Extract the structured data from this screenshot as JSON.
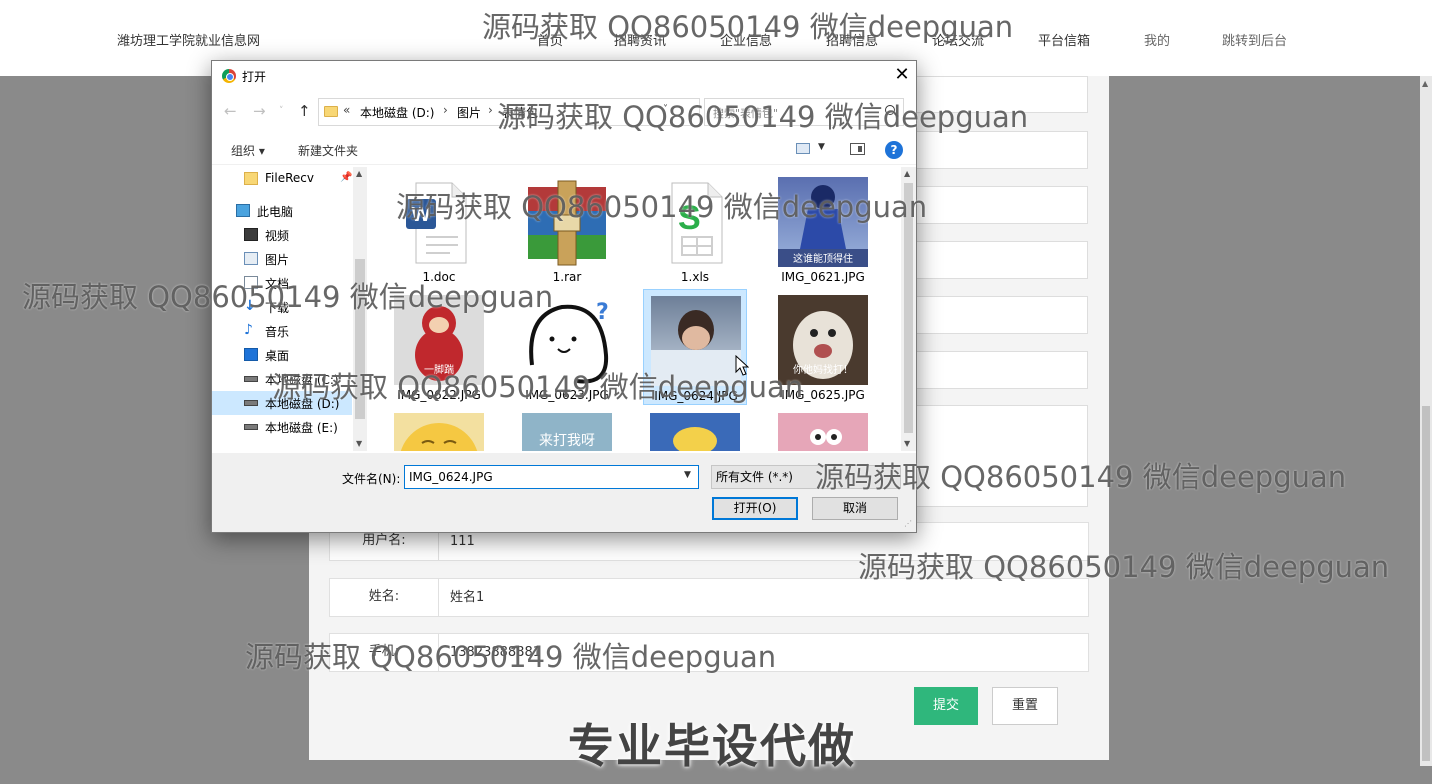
{
  "site": {
    "title": "潍坊理工学院就业信息网",
    "nav": [
      "首页",
      "招聘资讯",
      "企业信息",
      "招聘信息",
      "论坛交流",
      "平台信箱",
      "我的",
      "跳转到后台"
    ]
  },
  "form": {
    "username_label": "用户名:",
    "username_value": "111",
    "name_label": "姓名:",
    "name_value": "姓名1",
    "phone_label": "手机:",
    "phone_value": "13823888881",
    "submit_label": "提交",
    "reset_label": "重置"
  },
  "dialog": {
    "title": "打开",
    "close_glyph": "✕",
    "breadcrumb": [
      "本地磁盘 (D:)",
      "图片",
      "表情包"
    ],
    "breadcrumb_overflow": "«",
    "search_placeholder": "搜索\"表情包\"",
    "organize_label": "组织 ▾",
    "new_folder_label": "新建文件夹",
    "help_glyph": "?",
    "nav_tree": [
      {
        "label": "FileRecv",
        "icon": "folder-icon"
      },
      {
        "label": "此电脑",
        "icon": "computer-icon"
      },
      {
        "label": "视频",
        "icon": "video-icon"
      },
      {
        "label": "图片",
        "icon": "pictures-icon"
      },
      {
        "label": "文档",
        "icon": "documents-icon"
      },
      {
        "label": "下载",
        "icon": "download-icon"
      },
      {
        "label": "音乐",
        "icon": "music-icon"
      },
      {
        "label": "桌面",
        "icon": "desktop-icon"
      },
      {
        "label": "本地磁盘 (C:)",
        "icon": "drive-icon"
      },
      {
        "label": "本地磁盘 (D:)",
        "icon": "drive-icon",
        "selected": true
      },
      {
        "label": "本地磁盘 (E:)",
        "icon": "drive-icon"
      }
    ],
    "files": [
      {
        "name": "1.doc",
        "icon": "word-document-icon"
      },
      {
        "name": "1.rar",
        "icon": "winrar-archive-icon"
      },
      {
        "name": "1.xls",
        "icon": "spreadsheet-icon"
      },
      {
        "name": "IMG_0621.JPG",
        "icon": "image-thumbnail",
        "caption": "这谁能顶得住"
      },
      {
        "name": "IMG_0622.JPG",
        "icon": "image-thumbnail",
        "caption": "一脚踹"
      },
      {
        "name": "IMG_0623.JPG",
        "icon": "image-thumbnail"
      },
      {
        "name": "IMG_0624.JPG",
        "icon": "image-thumbnail",
        "selected": true
      },
      {
        "name": "IMG_0625.JPG",
        "icon": "image-thumbnail",
        "caption": "你他妈找打！"
      },
      {
        "name": "",
        "icon": "image-thumbnail"
      },
      {
        "name": "",
        "icon": "image-thumbnail",
        "caption": "来打我呀"
      },
      {
        "name": "",
        "icon": "image-thumbnail"
      },
      {
        "name": "",
        "icon": "image-thumbnail"
      }
    ],
    "filename_label": "文件名(N):",
    "filename_value": "IMG_0624.JPG",
    "filetype_value": "所有文件 (*.*)",
    "open_label": "打开(O)",
    "cancel_label": "取消"
  },
  "watermark_text": "源码获取 QQ86050149 微信deepguan",
  "promo_banner": "专业毕设代做",
  "colors": {
    "submit_green": "#2fb77c",
    "selection_blue": "#cce8ff",
    "focus_blue": "#0078d7"
  }
}
